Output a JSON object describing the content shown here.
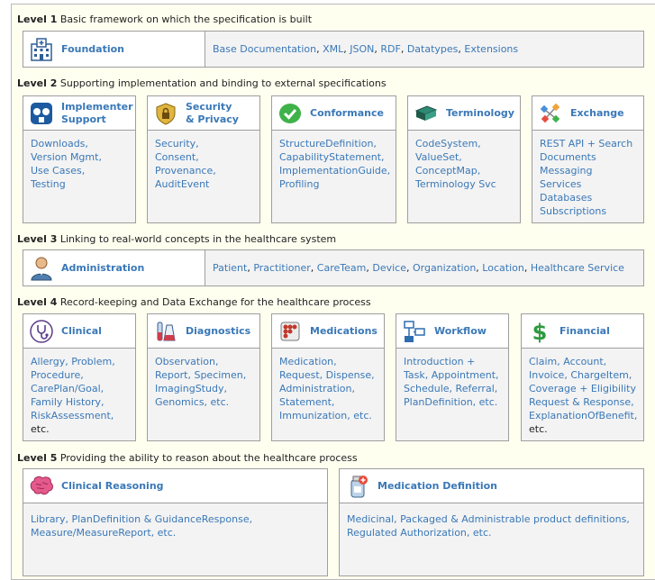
{
  "levels": [
    {
      "num": "Level 1",
      "text": "Basic framework on which the specification is built"
    },
    {
      "num": "Level 2",
      "text": "Supporting implementation and binding to external specifications"
    },
    {
      "num": "Level 3",
      "text": "Linking to real-world concepts in the healthcare system"
    },
    {
      "num": "Level 4",
      "text": "Record-keeping and Data Exchange for the healthcare process"
    },
    {
      "num": "Level 5",
      "text": "Providing the ability to reason about the healthcare process"
    }
  ],
  "foundation": {
    "title": "Foundation",
    "links": [
      "Base Documentation",
      "XML",
      "JSON",
      "RDF",
      "Datatypes",
      "Extensions"
    ]
  },
  "level2": [
    {
      "title1": "Implementer",
      "title2": "Support",
      "icon": "implementer-icon",
      "lines": [
        "Downloads,",
        "Version Mgmt,",
        "Use Cases,",
        "Testing"
      ]
    },
    {
      "title1": "Security",
      "title2": "& Privacy",
      "icon": "security-icon",
      "lines": [
        "Security,",
        "Consent,",
        "Provenance,",
        "AuditEvent"
      ]
    },
    {
      "title1": "Conformance",
      "title2": "",
      "icon": "conformance-icon",
      "lines": [
        "StructureDefinition,",
        "CapabilityStatement,",
        "ImplementationGuide,",
        "Profiling"
      ]
    },
    {
      "title1": "Terminology",
      "title2": "",
      "icon": "terminology-icon",
      "lines": [
        "CodeSystem,",
        "ValueSet,",
        "ConceptMap,",
        "Terminology Svc"
      ]
    },
    {
      "title1": "Exchange",
      "title2": "",
      "icon": "exchange-icon",
      "lines": [
        "REST API + Search",
        "Documents",
        "Messaging",
        "Services",
        "Databases",
        "Subscriptions"
      ]
    }
  ],
  "administration": {
    "title": "Administration",
    "links": [
      "Patient",
      "Practitioner",
      "CareTeam",
      "Device",
      "Organization",
      "Location",
      "Healthcare Service"
    ]
  },
  "level4": [
    {
      "title": "Clinical",
      "icon": "stethoscope-icon",
      "lines": [
        "Allergy, Problem,",
        "Procedure,",
        "CarePlan/Goal,",
        "Family History,",
        "RiskAssessment,",
        "etc."
      ]
    },
    {
      "title": "Diagnostics",
      "icon": "diagnostics-icon",
      "lines": [
        "Observation,",
        "Report, Specimen,",
        "ImagingStudy,",
        "Genomics, etc."
      ]
    },
    {
      "title": "Medications",
      "icon": "medications-icon",
      "lines": [
        "Medication,",
        "Request, Dispense,",
        "Administration,",
        "Statement,",
        "Immunization, etc."
      ]
    },
    {
      "title": "Workflow",
      "icon": "workflow-icon",
      "lines": [
        "Introduction +",
        "Task, Appointment,",
        "Schedule, Referral,",
        "PlanDefinition, etc."
      ]
    },
    {
      "title": "Financial",
      "icon": "financial-icon",
      "lines": [
        "Claim, Account,",
        "Invoice, ChargeItem,",
        "Coverage + Eligibility",
        "Request & Response,",
        "ExplanationOfBenefit,",
        "etc."
      ]
    }
  ],
  "level5": [
    {
      "title": "Clinical Reasoning",
      "icon": "brain-icon",
      "lines": [
        "Library, PlanDefinition & GuidanceResponse,",
        "Measure/MeasureReport, etc."
      ]
    },
    {
      "title": "Medication Definition",
      "icon": "medication-definition-icon",
      "lines": [
        "Medicinal, Packaged & Administrable product definitions,",
        "Regulated Authorization, etc."
      ]
    }
  ],
  "colors": {
    "link": "#3a78b7",
    "panel": "#fffff0",
    "box": "#f3f3f3"
  }
}
